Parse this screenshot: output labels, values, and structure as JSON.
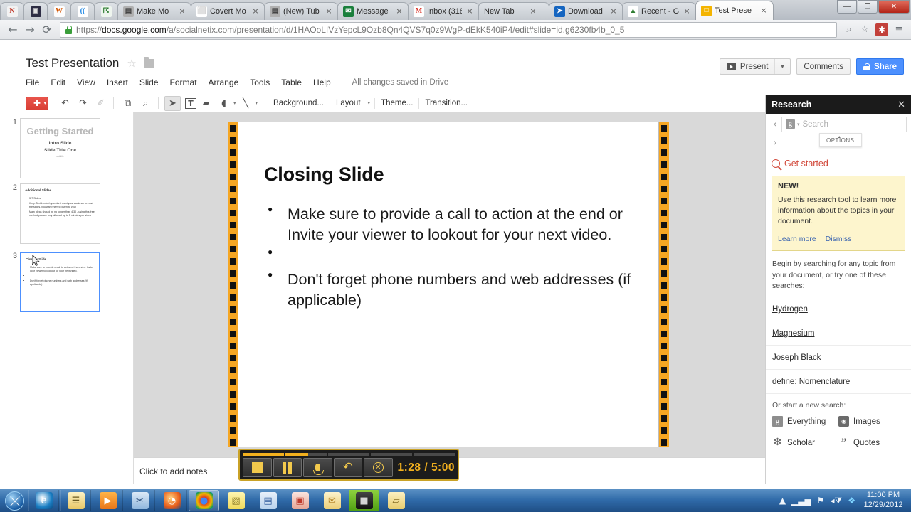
{
  "browser": {
    "pinned_tabs": [
      {
        "name": "pinned-tab-1",
        "glyph": "N",
        "bg": "#f2f2f2",
        "fg": "#c0392b"
      },
      {
        "name": "pinned-tab-2",
        "glyph": "▣",
        "bg": "#2d2d44",
        "fg": "#e0e0e0"
      },
      {
        "name": "pinned-tab-3",
        "glyph": "W",
        "bg": "#fdfdfd",
        "fg": "#d35400"
      },
      {
        "name": "pinned-tab-4",
        "glyph": "((",
        "bg": "#ffffff",
        "fg": "#1e88e5"
      },
      {
        "name": "pinned-tab-5",
        "glyph": "☈",
        "bg": "#eef5ee",
        "fg": "#2e7d32"
      }
    ],
    "tabs": [
      {
        "title": "Make Mo",
        "favicon": "▤",
        "fav_bg": "#b0b0b0",
        "fav_fg": "#444",
        "active": false
      },
      {
        "title": "Covert Mo",
        "favicon": "⬜",
        "fav_bg": "#ffffff",
        "fav_fg": "#999",
        "active": false
      },
      {
        "title": "(New) Tub",
        "favicon": "▤",
        "fav_bg": "#b0b0b0",
        "fav_fg": "#444",
        "active": false
      },
      {
        "title": "Message (",
        "favicon": "✉",
        "fav_bg": "#1a7f3c",
        "fav_fg": "#fff",
        "active": false
      },
      {
        "title": "Inbox (318",
        "favicon": "M",
        "fav_bg": "#ffffff",
        "fav_fg": "#d93025",
        "active": false
      },
      {
        "title": "New Tab",
        "favicon": "",
        "fav_bg": "transparent",
        "fav_fg": "#888",
        "active": false
      },
      {
        "title": "Download",
        "favicon": "➤",
        "fav_bg": "#1565c0",
        "fav_fg": "#fff",
        "active": false
      },
      {
        "title": "Recent - G",
        "favicon": "▲",
        "fav_bg": "#ffffff",
        "fav_fg": "#2e7d32",
        "active": false
      },
      {
        "title": "Test Prese",
        "favicon": "□",
        "fav_bg": "#f4b400",
        "fav_fg": "#fff",
        "active": true
      }
    ],
    "tab_close_label": "×",
    "window_controls": {
      "minimize": "—",
      "maximize": "❐",
      "close": "✕"
    },
    "nav": {
      "back": "←",
      "forward": "→",
      "reload": "⟳"
    },
    "url_scheme": "https://",
    "url_host": "docs.google.com",
    "url_path": "/a/socialnetix.com/presentation/d/1HAOoLIVzYepcL9Ozb8Qn4QVS7q0z9WgP-dEkK540iP4/edit#slide=id.g6230fb4b_0_5",
    "omni_zoom_icon": "⌕",
    "omni_star_icon": "☆",
    "extension_icon": "✱",
    "menu_icon": "≡"
  },
  "docs": {
    "title": "Test Presentation",
    "star_icon": "☆",
    "menu": [
      "File",
      "Edit",
      "View",
      "Insert",
      "Slide",
      "Format",
      "Arrange",
      "Tools",
      "Table",
      "Help"
    ],
    "save_state": "All changes saved in Drive",
    "present_label": "Present",
    "present_caret": "▼",
    "comments_label": "Comments",
    "share_label": "Share",
    "toolbar": {
      "new_slide_glyph": "✚",
      "new_slide_caret": "▾",
      "undo_icon": "↶",
      "redo_icon": "↷",
      "paint_icon": "✐",
      "fit_icon": "⧉",
      "zoom_icon": "⌕",
      "select_icon": "➤",
      "textbox_icon": "T",
      "image_icon": "▰",
      "shape_icon": "◖",
      "shape_caret": "▾",
      "line_icon": "╲",
      "line_caret": "▾",
      "background_label": "Background...",
      "layout_label": "Layout",
      "layout_caret": "▾",
      "theme_label": "Theme...",
      "transition_label": "Transition..."
    }
  },
  "filmstrip": {
    "slides": [
      {
        "number": "1",
        "selected": false,
        "kind": "title",
        "title": "Getting Started",
        "subtitle": "Intro Slide\nSlide Title One",
        "tiny": "subtitle"
      },
      {
        "number": "2",
        "selected": false,
        "kind": "bullets",
        "heading": "Additional Slides",
        "bullets": [
          "3-7 Slides",
          "Keep Text Limited (you don't want your audience to read the slides, you want them to listen to you)",
          "Main Ideas should be no longer than 4:30 - using this free method you are only allowed up to 5 minutes per video"
        ]
      },
      {
        "number": "3",
        "selected": true,
        "kind": "bullets",
        "heading": "Closing Slide",
        "bullets": [
          "Make sure to provide a call to action at the end or Invite your viewer to lookout for your next video.",
          "",
          "Don't forget phone numbers and web addresses (if applicable)"
        ]
      }
    ]
  },
  "slide": {
    "title": "Closing Slide",
    "bullets": [
      "Make sure to provide a call to action at the end or Invite your viewer to lookout for your next video.",
      "",
      "Don't forget phone numbers and web addresses (if applicable)"
    ],
    "border_color": "#F5A623"
  },
  "notes": {
    "placeholder": "Click to add notes"
  },
  "research": {
    "title": "Research",
    "close_icon": "✕",
    "collapse_icon": "‹",
    "expand_icon": "›",
    "search_placeholder": "Search",
    "search_engine_glyph": "g",
    "search_caret": "▾",
    "options_label": "OPTIONS",
    "options_caret": "▴",
    "get_started": "Get started",
    "promo": {
      "badge": "NEW!",
      "body": "Use this research tool to learn more information about the topics in your document.",
      "learn_more": "Learn more",
      "dismiss": "Dismiss"
    },
    "begin_text": "Begin by searching for any topic from your document, or try one of these searches:",
    "suggestions": [
      "Hydrogen",
      "Magnesium",
      "Joseph Black",
      "define: Nomenclature"
    ],
    "new_search_label": "Or start a new search:",
    "search_types": [
      {
        "label": "Everything",
        "glyph": "g",
        "style": "g"
      },
      {
        "label": "Images",
        "glyph": "◉",
        "style": "cam"
      },
      {
        "label": "Scholar",
        "glyph": "✻",
        "style": "sch"
      },
      {
        "label": "Quotes",
        "glyph": "”",
        "style": "qt"
      }
    ]
  },
  "recorder": {
    "segments": [
      1,
      0.55,
      0,
      0,
      0
    ],
    "stop_label": "stop",
    "pause_label": "pause",
    "mic_label": "mic",
    "undo_label": "undo",
    "cancel_label": "cancel",
    "time": "1:28 / 5:00"
  },
  "taskbar": {
    "items": [
      {
        "name": "taskbar-item-internet-explorer",
        "glyph": "e",
        "bg": "radial-gradient(circle at 40% 35%, #ffffff, #1b7fc4 60%, #0c4d85)",
        "fg": "#ffffff",
        "active": false
      },
      {
        "name": "taskbar-item-notepad",
        "glyph": "☰",
        "bg": "linear-gradient(#fdf2c4, #e8c766)",
        "fg": "#6a5a20",
        "active": false
      },
      {
        "name": "taskbar-item-media-player",
        "glyph": "▶",
        "bg": "linear-gradient(#ffb347, #e8761a)",
        "fg": "#ffffff",
        "active": false
      },
      {
        "name": "taskbar-item-snipping-tool",
        "glyph": "✂",
        "bg": "linear-gradient(#dce9f7, #8fb7dd)",
        "fg": "#2a4d7a",
        "active": false
      },
      {
        "name": "taskbar-item-firefox",
        "glyph": "◔",
        "bg": "radial-gradient(circle at 40% 35%, #ffd27f, #e85d1a 60%, #2c4f82)",
        "fg": "#ffffff",
        "active": false
      },
      {
        "name": "taskbar-item-chrome",
        "glyph": "●",
        "bg": "radial-gradient(circle at 50% 50%, #ffffff 22%, #d93025 24%, #f4b400 60%, #0f9d58 85%, #4285f4)",
        "fg": "#4285f4",
        "active": true
      },
      {
        "name": "taskbar-item-sticky-notes",
        "glyph": "▧",
        "bg": "linear-gradient(#fff6b0, #f0d95a)",
        "fg": "#8a7a28",
        "active": false
      },
      {
        "name": "taskbar-item-word",
        "glyph": "▤",
        "bg": "linear-gradient(#e8f0fa, #b9d2ec)",
        "fg": "#2b579a",
        "active": false
      },
      {
        "name": "taskbar-item-powerpoint",
        "glyph": "▣",
        "bg": "linear-gradient(#fbe3dd, #e8a695)",
        "fg": "#c0392b",
        "active": false
      },
      {
        "name": "taskbar-item-outlook",
        "glyph": "✉",
        "bg": "linear-gradient(#fdf3cd, #eccf77)",
        "fg": "#b07d20",
        "active": false
      },
      {
        "name": "taskbar-item-camtasia-recorder",
        "glyph": "■",
        "bg": "linear-gradient(#444, #111)",
        "fg": "#d4d4d4",
        "active": false,
        "highlight": true
      },
      {
        "name": "taskbar-item-folder",
        "glyph": "▱",
        "bg": "linear-gradient(#fdf0c0, #e8cd6e)",
        "fg": "#8a7026",
        "active": false
      }
    ],
    "tray": {
      "show_hidden": "▲",
      "network": "▁▃▅",
      "action_center": "⚑",
      "volume": "◂⧩",
      "security": "❖",
      "time": "11:00 PM",
      "date": "12/29/2012"
    }
  }
}
